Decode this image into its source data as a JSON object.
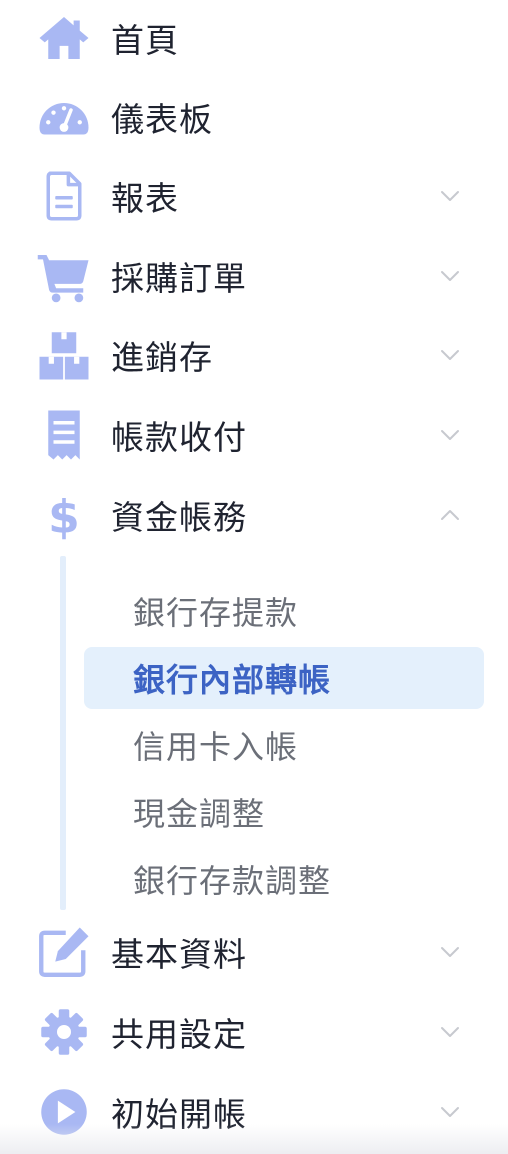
{
  "colors": {
    "icon": "#a9b8f3",
    "label": "#1f2330",
    "sub_label": "#6b6f78",
    "active_text": "#3c63c4",
    "active_bg": "#e4f0fc",
    "chevron": "#c7c9cf",
    "sub_line": "#e3eefb"
  },
  "menu": {
    "items": [
      {
        "label": "首頁",
        "icon": "home-icon",
        "has_chevron": false
      },
      {
        "label": "儀表板",
        "icon": "dashboard-gauge-icon",
        "has_chevron": false
      },
      {
        "label": "報表",
        "icon": "document-icon",
        "has_chevron": true,
        "chevron": "down"
      },
      {
        "label": "採購訂單",
        "icon": "shopping-cart-icon",
        "has_chevron": true,
        "chevron": "down"
      },
      {
        "label": "進銷存",
        "icon": "boxes-icon",
        "has_chevron": true,
        "chevron": "down"
      },
      {
        "label": "帳款收付",
        "icon": "receipt-icon",
        "has_chevron": true,
        "chevron": "down"
      },
      {
        "label": "資金帳務",
        "icon": "dollar-icon",
        "has_chevron": true,
        "chevron": "up",
        "expanded": true
      },
      {
        "label": "基本資料",
        "icon": "edit-icon",
        "has_chevron": true,
        "chevron": "down"
      },
      {
        "label": "共用設定",
        "icon": "gear-icon",
        "has_chevron": true,
        "chevron": "down"
      },
      {
        "label": "初始開帳",
        "icon": "play-circle-icon",
        "has_chevron": true,
        "chevron": "down"
      }
    ],
    "submenu": [
      {
        "label": "銀行存提款",
        "active": false
      },
      {
        "label": "銀行內部轉帳",
        "active": true
      },
      {
        "label": "信用卡入帳",
        "active": false
      },
      {
        "label": "現金調整",
        "active": false
      },
      {
        "label": "銀行存款調整",
        "active": false
      }
    ]
  }
}
